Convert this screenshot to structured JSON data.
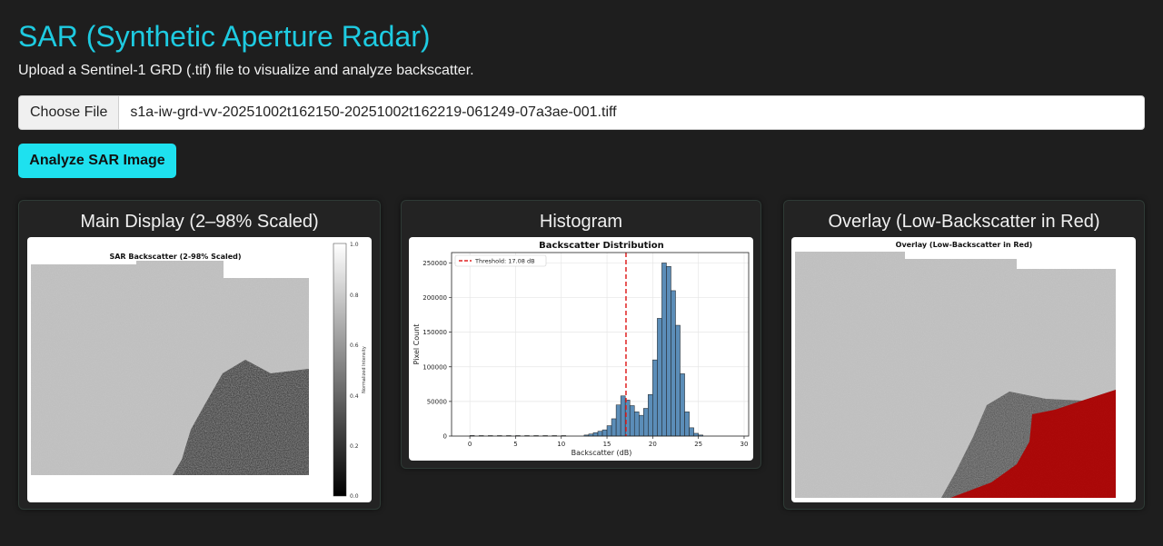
{
  "page": {
    "title": "SAR (Synthetic Aperture Radar)",
    "subtitle": "Upload a Sentinel-1 GRD (.tif) file to visualize and analyze backscatter."
  },
  "file_input": {
    "button_label": "Choose File",
    "file_name": "s1a-iw-grd-vv-20251002t162150-20251002t162219-061249-07a3ae-001.tiff"
  },
  "analyze_button": {
    "label": "Analyze SAR Image"
  },
  "panels": {
    "main": {
      "heading": "Main Display (2–98% Scaled)",
      "plot_title": "SAR Backscatter (2-98% Scaled)",
      "colorbar_label": "Normalized Intensity",
      "colorbar_ticks": [
        "0.0",
        "0.2",
        "0.4",
        "0.6",
        "0.8",
        "1.0"
      ]
    },
    "histogram": {
      "heading": "Histogram"
    },
    "overlay": {
      "heading": "Overlay (Low-Backscatter in Red)",
      "plot_title": "Overlay (Low-Backscatter in Red)"
    }
  },
  "colors": {
    "accent": "#1ecbe1",
    "button": "#1ee1ef",
    "bar_fill": "#5b8db8",
    "threshold_line": "#e02020",
    "overlay_red": "#c00000"
  },
  "chart_data": {
    "type": "bar",
    "title": "Backscatter Distribution",
    "xlabel": "Backscatter (dB)",
    "ylabel": "Pixel Count",
    "xlim": [
      -2,
      30.5
    ],
    "ylim": [
      0,
      265000
    ],
    "xticks": [
      0,
      5,
      10,
      15,
      20,
      25,
      30
    ],
    "yticks": [
      0,
      50000,
      100000,
      150000,
      200000,
      250000
    ],
    "grid": true,
    "legend": {
      "position": "top-left",
      "entries": [
        "Threshold: 17.08 dB"
      ]
    },
    "threshold": 17.08,
    "bin_width": 0.5,
    "bins": [
      [
        0.0,
        800
      ],
      [
        1.0,
        700
      ],
      [
        2.0,
        700
      ],
      [
        3.0,
        700
      ],
      [
        4.0,
        700
      ],
      [
        5.0,
        700
      ],
      [
        6.0,
        700
      ],
      [
        7.0,
        700
      ],
      [
        8.0,
        700
      ],
      [
        9.0,
        700
      ],
      [
        10.0,
        700
      ],
      [
        12.5,
        1500
      ],
      [
        13.0,
        3000
      ],
      [
        13.5,
        5000
      ],
      [
        14.0,
        7000
      ],
      [
        14.5,
        9000
      ],
      [
        15.0,
        15000
      ],
      [
        15.5,
        25000
      ],
      [
        16.0,
        45000
      ],
      [
        16.5,
        58000
      ],
      [
        17.0,
        52000
      ],
      [
        17.5,
        44000
      ],
      [
        18.0,
        35000
      ],
      [
        18.5,
        30000
      ],
      [
        19.0,
        40000
      ],
      [
        19.5,
        60000
      ],
      [
        20.0,
        110000
      ],
      [
        20.5,
        170000
      ],
      [
        21.0,
        250000
      ],
      [
        21.5,
        245000
      ],
      [
        22.0,
        210000
      ],
      [
        22.5,
        160000
      ],
      [
        23.0,
        90000
      ],
      [
        23.5,
        35000
      ],
      [
        24.0,
        12000
      ],
      [
        24.5,
        4000
      ],
      [
        25.0,
        1500
      ]
    ]
  }
}
